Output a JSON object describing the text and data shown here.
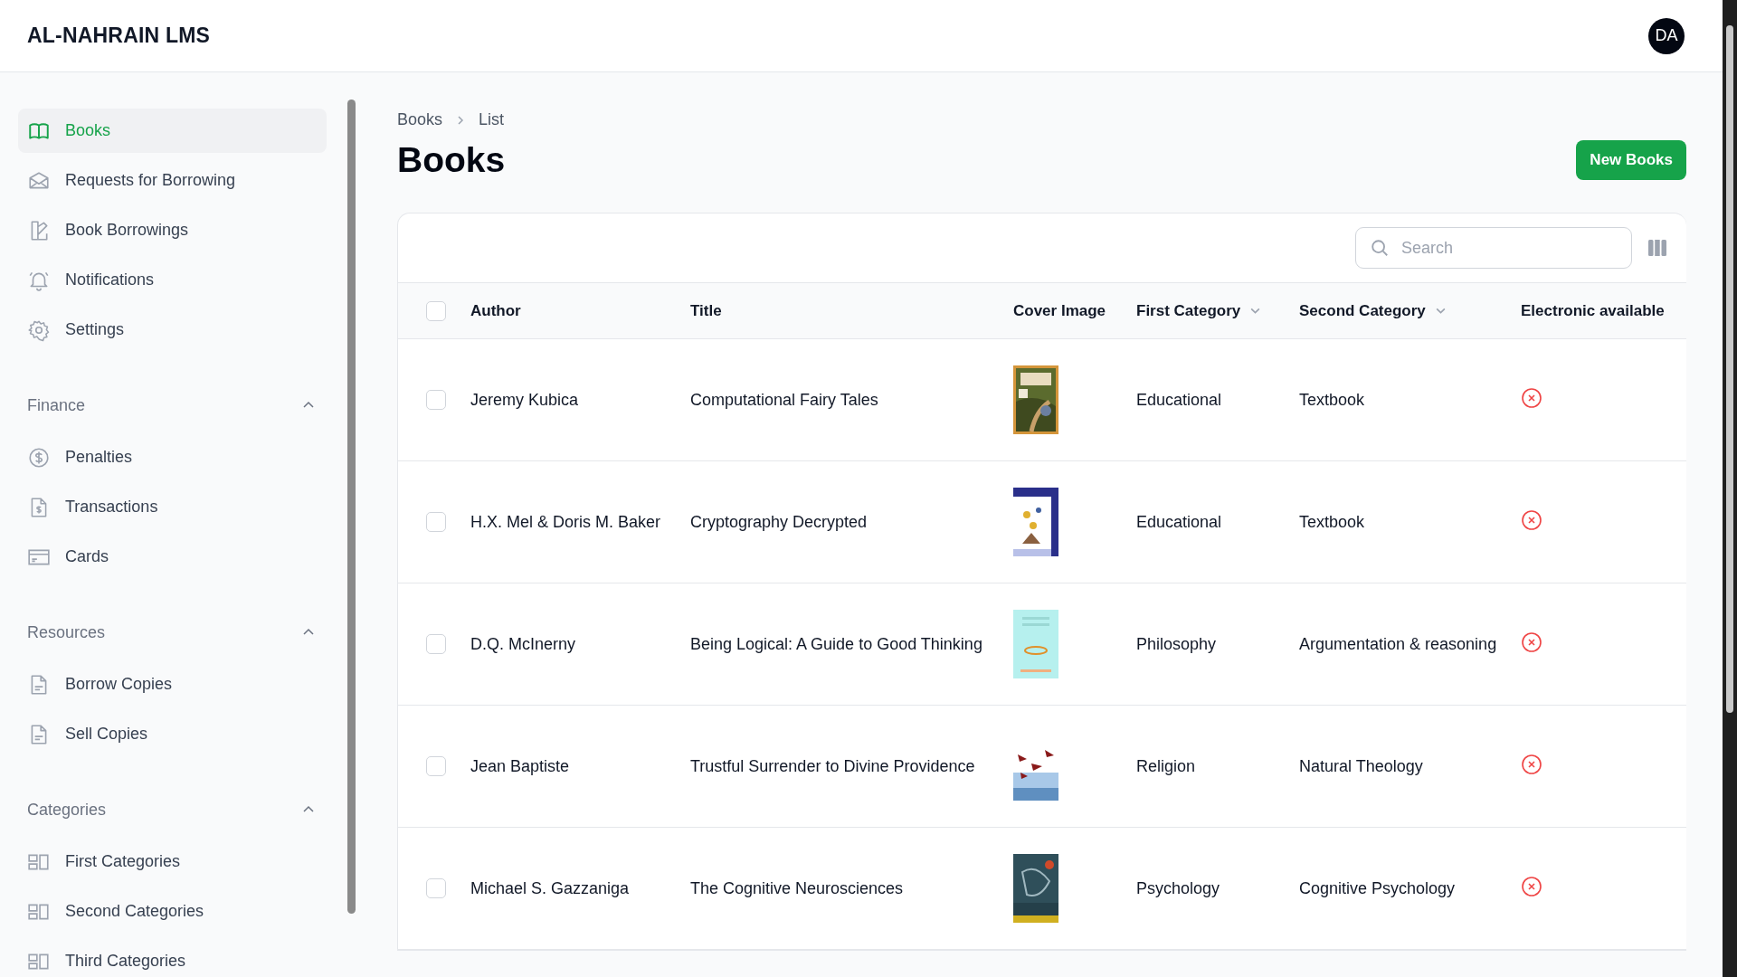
{
  "app": {
    "title": "AL-NAHRAIN LMS",
    "avatar": "DA"
  },
  "sidebar": {
    "items": [
      {
        "label": "Books",
        "kind": "book",
        "selected": true
      },
      {
        "label": "Requests for Borrowing",
        "kind": "envelope",
        "selected": false
      },
      {
        "label": "Book Borrowings",
        "kind": "borrow",
        "selected": false
      },
      {
        "label": "Notifications",
        "kind": "bell",
        "selected": false
      },
      {
        "label": "Settings",
        "kind": "gear",
        "selected": false
      }
    ],
    "groups": [
      {
        "label": "Finance",
        "expanded": true,
        "items": [
          {
            "label": "Penalties",
            "kind": "dollar",
            "selected": false
          },
          {
            "label": "Transactions",
            "kind": "receipt",
            "selected": false
          },
          {
            "label": "Cards",
            "kind": "card",
            "selected": false
          }
        ]
      },
      {
        "label": "Resources",
        "expanded": true,
        "items": [
          {
            "label": "Borrow Copies",
            "kind": "doc",
            "selected": false
          },
          {
            "label": "Sell Copies",
            "kind": "doc",
            "selected": false
          }
        ]
      },
      {
        "label": "Categories",
        "expanded": true,
        "items": [
          {
            "label": "First Categories",
            "kind": "grid",
            "selected": false
          },
          {
            "label": "Second Categories",
            "kind": "grid",
            "selected": false
          },
          {
            "label": "Third Categories",
            "kind": "grid",
            "selected": false
          }
        ]
      }
    ]
  },
  "breadcrumb": [
    "Books",
    "List"
  ],
  "page_title": "Books",
  "new_button": "New Books",
  "search": {
    "placeholder": "Search"
  },
  "table": {
    "select_all": {
      "checked": false
    },
    "columns": [
      {
        "label": "Author",
        "kind": "plain"
      },
      {
        "label": "Title",
        "kind": "plain"
      },
      {
        "label": "Cover Image",
        "kind": "plain"
      },
      {
        "label": "First Category",
        "kind": "filter"
      },
      {
        "label": "Second Category",
        "kind": "filter"
      },
      {
        "label": "Electronic available",
        "kind": "plain"
      }
    ],
    "rows": [
      {
        "checked": false,
        "author": "Jeremy Kubica",
        "title": "Computational Fairy Tales",
        "first_category": "Educational",
        "second_category": "Textbook",
        "electronic_available": false
      },
      {
        "checked": false,
        "author": "H.X. Mel & Doris M. Baker",
        "title": "Cryptography Decrypted",
        "first_category": "Educational",
        "second_category": "Textbook",
        "electronic_available": false
      },
      {
        "checked": false,
        "author": "D.Q. McInerny",
        "title": "Being Logical: A Guide to Good Thinking",
        "first_category": "Philosophy",
        "second_category": "Argumentation & reasoning",
        "electronic_available": false
      },
      {
        "checked": false,
        "author": "Jean Baptiste",
        "title": "Trustful Surrender to Divine Providence",
        "first_category": "Religion",
        "second_category": "Natural Theology",
        "electronic_available": false
      },
      {
        "checked": false,
        "author": "Michael S. Gazzaniga",
        "title": "The Cognitive Neurosciences",
        "first_category": "Psychology",
        "second_category": "Cognitive Psychology",
        "electronic_available": false
      }
    ]
  }
}
